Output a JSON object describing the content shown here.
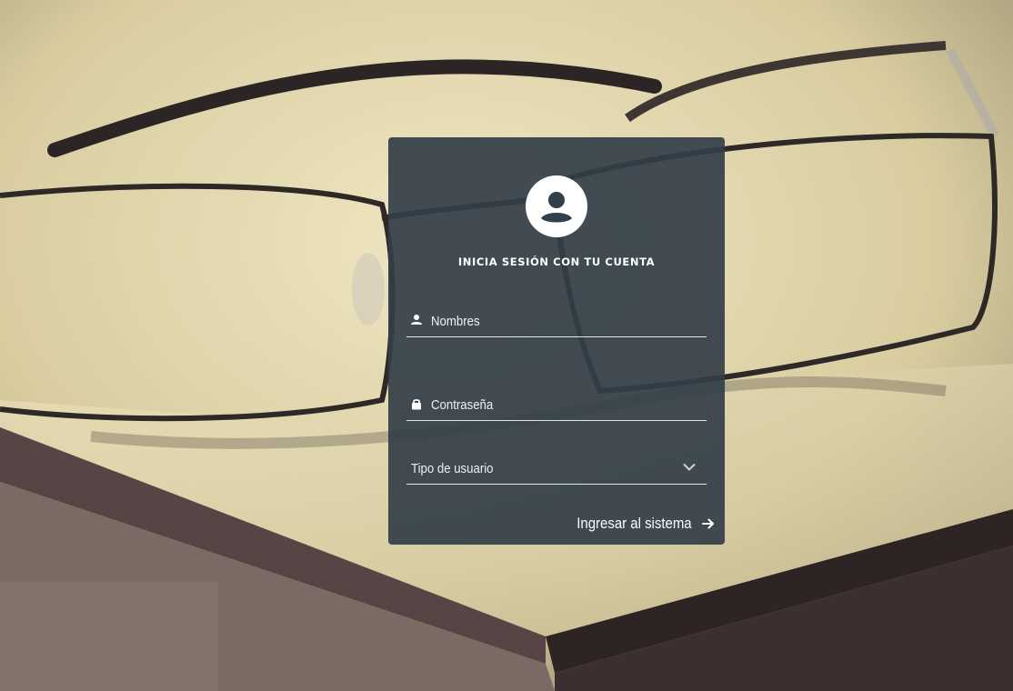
{
  "login": {
    "title": "INICIA SESIÓN CON TU CUENTA",
    "username_placeholder": "Nombres",
    "password_placeholder": "Contraseña",
    "user_type_label": "Tipo de usuario",
    "submit_label": "Ingresar al sistema"
  },
  "icons": {
    "avatar": "user-circle-icon",
    "username": "person-icon",
    "password": "lock-icon",
    "select": "chevron-down-icon",
    "submit": "arrow-right-icon"
  },
  "colors": {
    "card_background": "#323e48",
    "text": "#ffffff",
    "underline": "#e6e6e6"
  }
}
